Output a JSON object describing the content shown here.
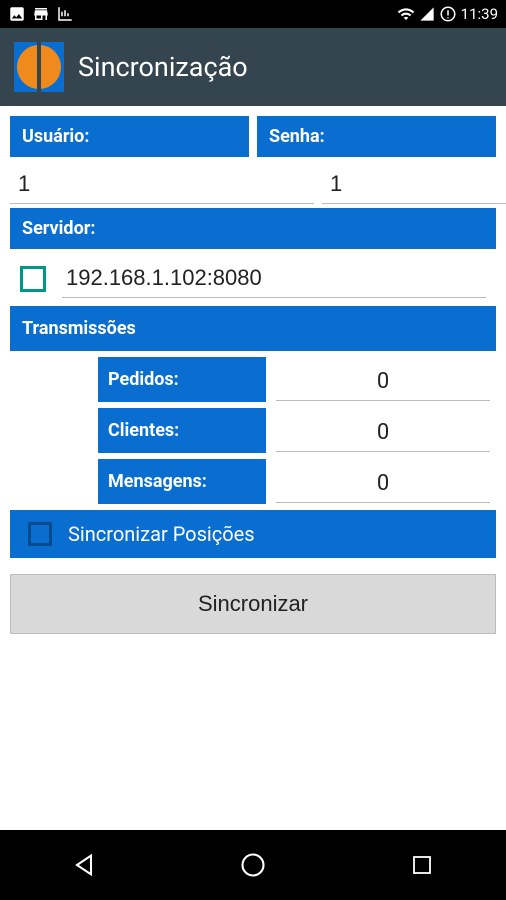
{
  "statusBar": {
    "time": "11:39"
  },
  "actionBar": {
    "title": "Sincronização"
  },
  "form": {
    "userLabel": "Usuário:",
    "userValue": "1",
    "passLabel": "Senha:",
    "passValue": "1",
    "serverLabel": "Servidor:",
    "serverValue": "192.168.1.102:8080"
  },
  "transmissions": {
    "header": "Transmissões",
    "items": [
      {
        "label": "Pedidos:",
        "value": "0"
      },
      {
        "label": "Clientes:",
        "value": "0"
      },
      {
        "label": "Mensagens:",
        "value": "0"
      }
    ]
  },
  "syncPositions": {
    "label": "Sincronizar Posições"
  },
  "syncButton": {
    "label": "Sincronizar"
  }
}
